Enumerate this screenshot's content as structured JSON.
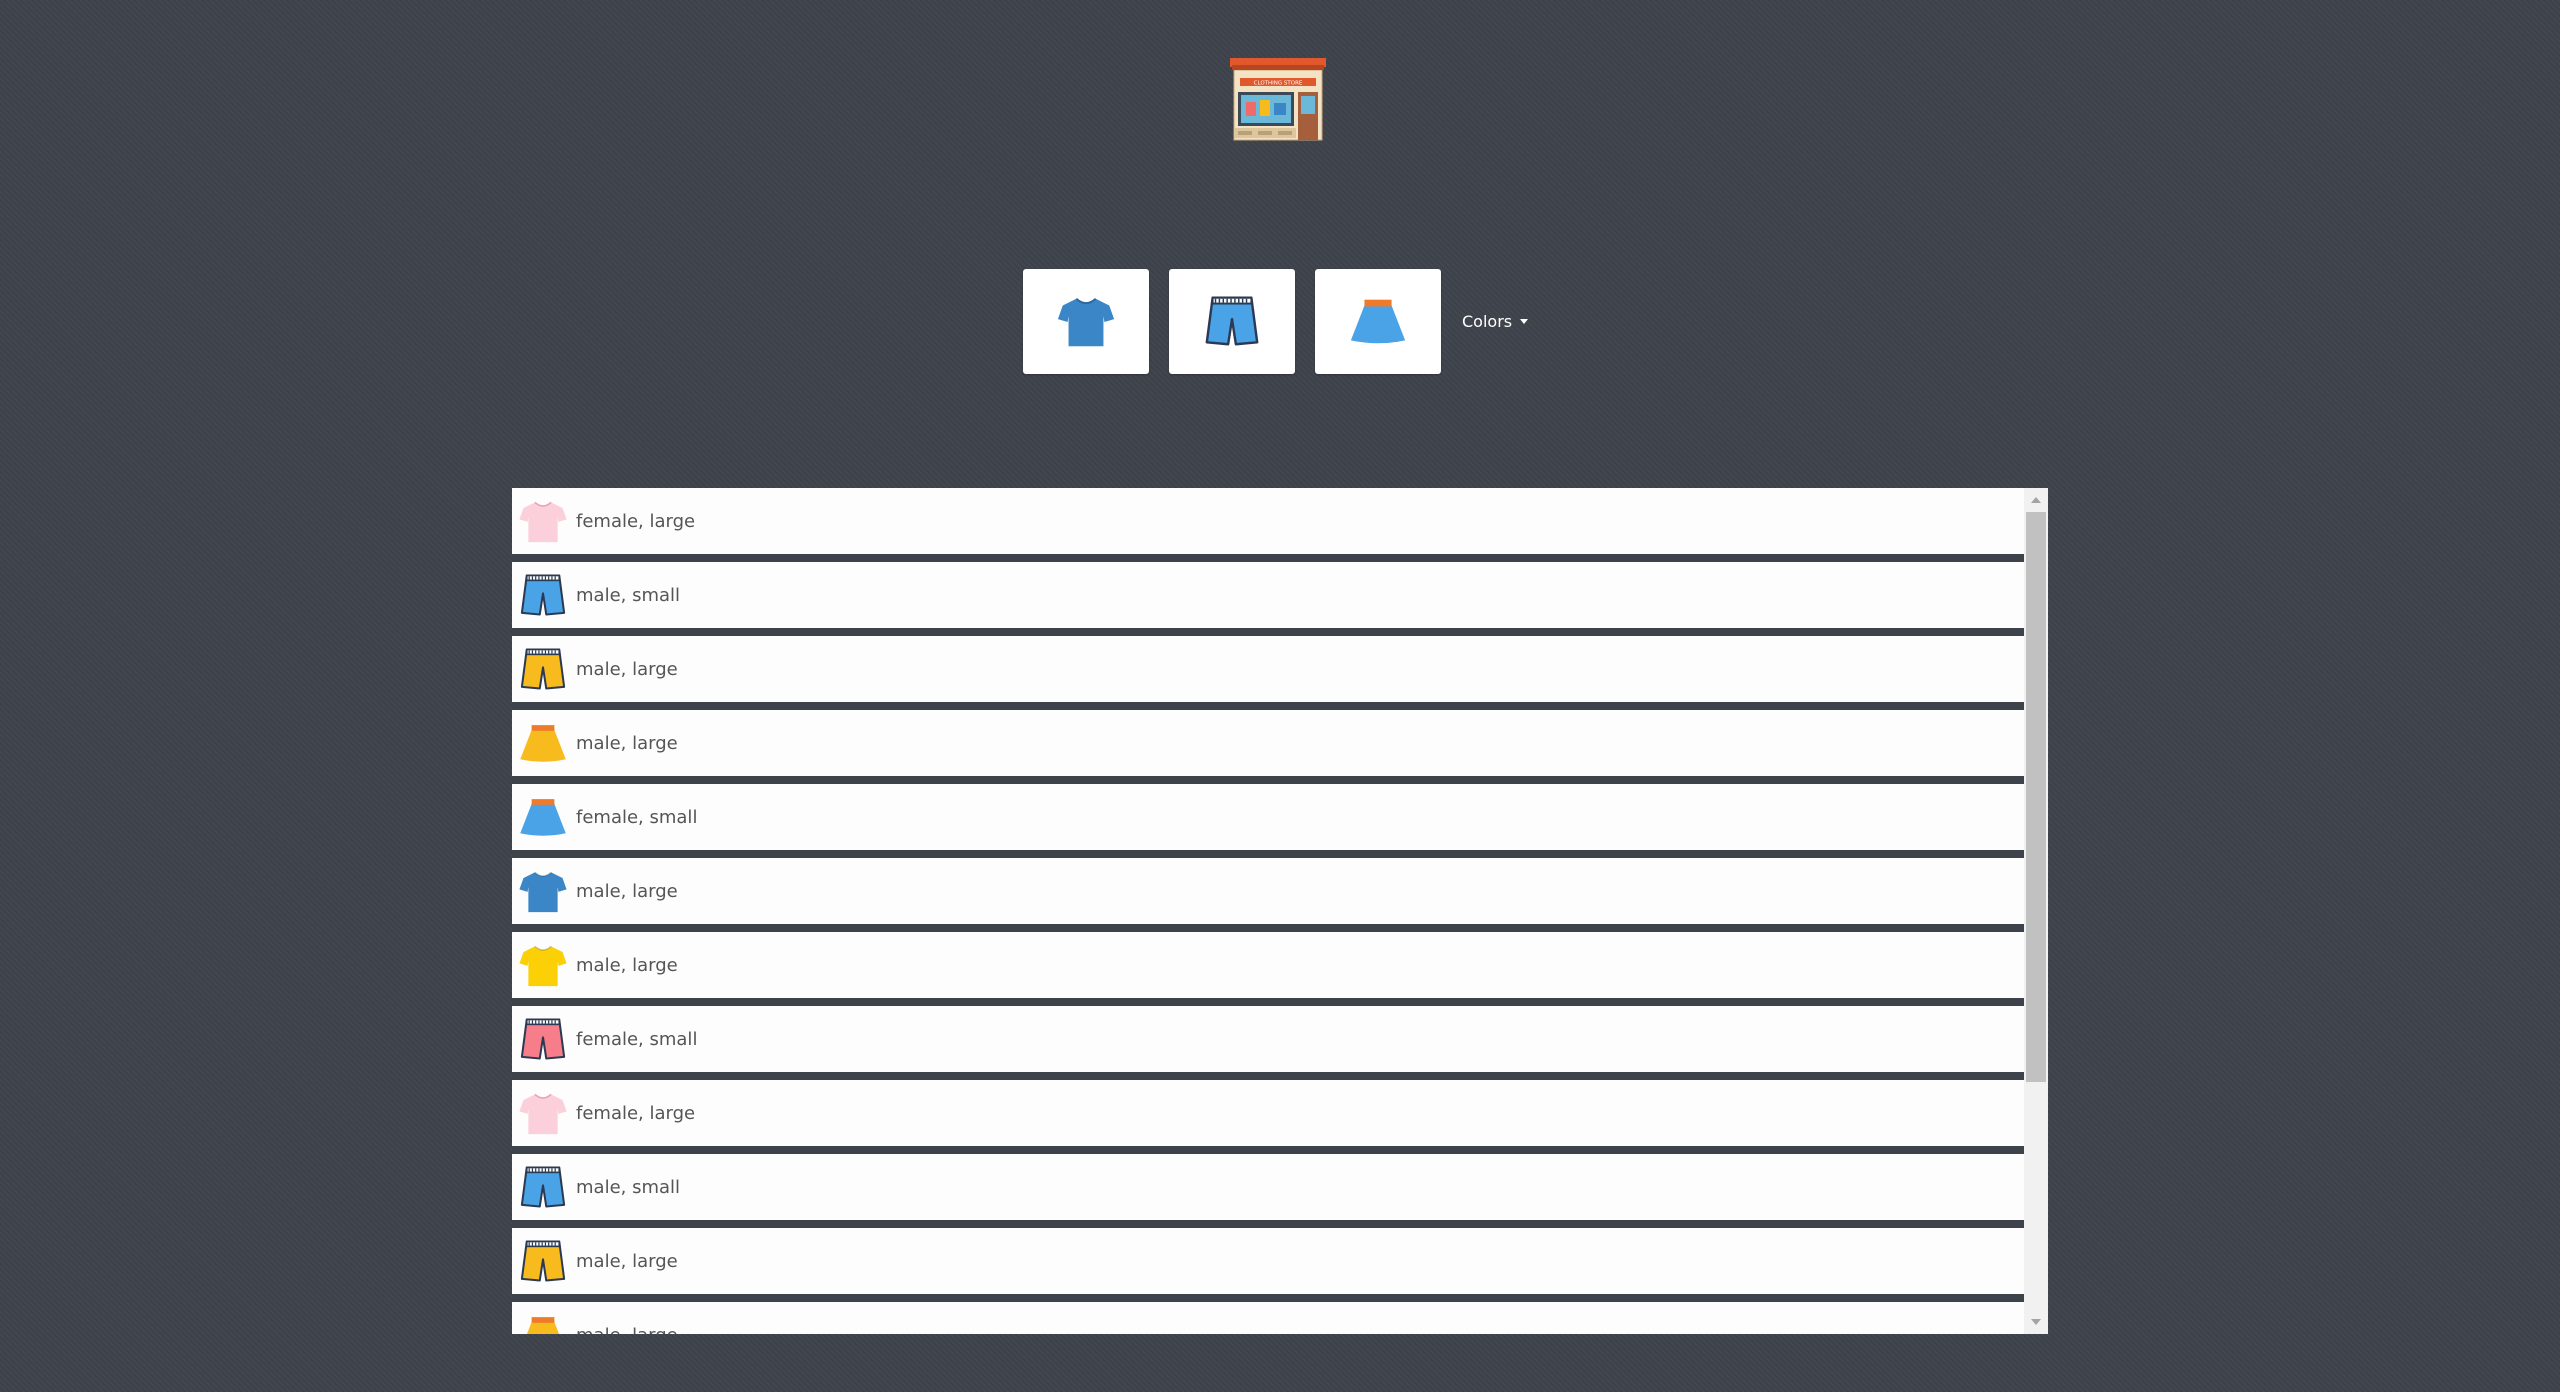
{
  "logo": {
    "icon": "clothing-store-icon",
    "sign_text": "CLOTHING STORE"
  },
  "filters": {
    "items": [
      {
        "name": "shirt",
        "icon": "tshirt-icon",
        "color": "#3b86c6"
      },
      {
        "name": "shorts",
        "icon": "shorts-icon",
        "color": "#4aa3e6"
      },
      {
        "name": "skirt",
        "icon": "skirt-icon",
        "color": "#4aa3e6"
      }
    ],
    "colors_label": "Colors"
  },
  "list": {
    "items": [
      {
        "type": "tshirt",
        "color": "#fbd0da",
        "label": "female, large"
      },
      {
        "type": "shorts",
        "color": "#4aa3e6",
        "label": "male, small"
      },
      {
        "type": "shorts",
        "color": "#f8bb1e",
        "label": "male, large"
      },
      {
        "type": "skirt",
        "color": "#f8bb1e",
        "label": "male, large"
      },
      {
        "type": "skirt",
        "color": "#4aa3e6",
        "label": "female, small"
      },
      {
        "type": "tshirt",
        "color": "#3b86c6",
        "label": "male, large"
      },
      {
        "type": "tshirt",
        "color": "#fbd007",
        "label": "male, large"
      },
      {
        "type": "shorts",
        "color": "#f77d8a",
        "label": "female, small"
      },
      {
        "type": "tshirt",
        "color": "#fbd0da",
        "label": "female, large"
      },
      {
        "type": "shorts",
        "color": "#4aa3e6",
        "label": "male, small"
      },
      {
        "type": "shorts",
        "color": "#f8bb1e",
        "label": "male, large"
      },
      {
        "type": "skirt",
        "color": "#f8bb1e",
        "label": "male, large"
      }
    ]
  }
}
